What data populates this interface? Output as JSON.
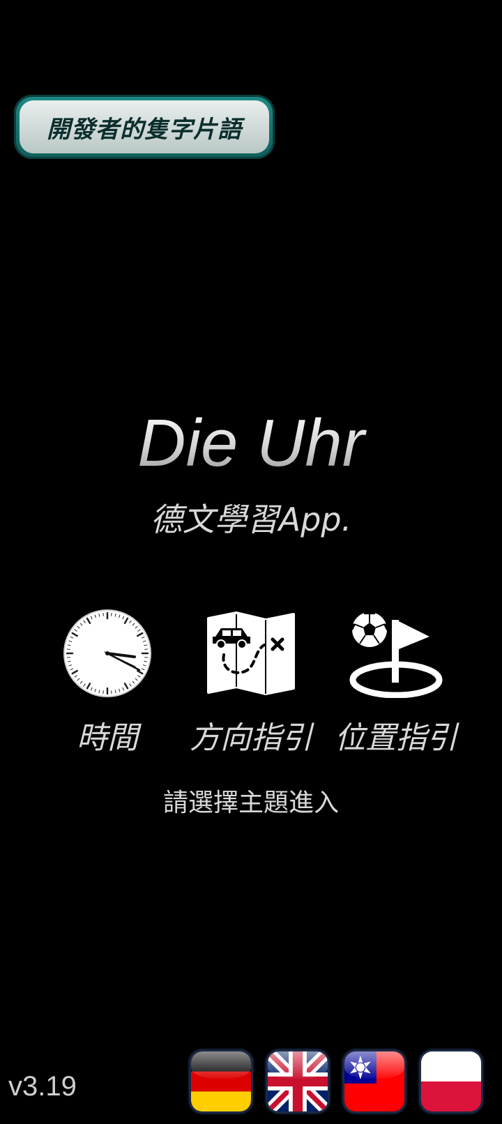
{
  "header": {
    "developer_notes_label": "開發者的隻字片語"
  },
  "app": {
    "title": "Die Uhr",
    "subtitle": "德文學習App."
  },
  "topics": [
    {
      "label": "時間",
      "icon": "clock-icon"
    },
    {
      "label": "方向指引",
      "icon": "map-car-icon"
    },
    {
      "label": "位置指引",
      "icon": "ball-flag-icon"
    }
  ],
  "prompt": "請選擇主題進入",
  "version": "v3.19",
  "languages": [
    {
      "name": "German",
      "icon": "germany-flag-icon"
    },
    {
      "name": "English",
      "icon": "uk-flag-icon"
    },
    {
      "name": "Traditional Chinese",
      "icon": "taiwan-flag-icon"
    },
    {
      "name": "Polish",
      "icon": "poland-flag-icon"
    }
  ],
  "colors": {
    "background": "#000000",
    "button_teal": "#1f8a86",
    "text": "#d9d9d9"
  }
}
